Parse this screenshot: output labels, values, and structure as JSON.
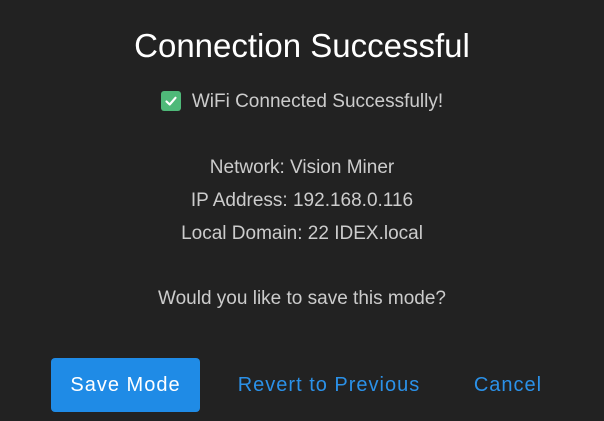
{
  "dialog": {
    "title": "Connection Successful",
    "status": {
      "icon": "check-icon",
      "icon_color": "#4fb979",
      "text": "WiFi Connected Successfully!"
    },
    "network_line": "Network: Vision Miner",
    "ip_line": "IP Address: 192.168.0.116",
    "domain_line": "Local Domain: 22 IDEX.local",
    "question": "Would you like to save this mode?",
    "buttons": {
      "save": "Save Mode",
      "revert": "Revert to Previous",
      "cancel": "Cancel"
    },
    "colors": {
      "background": "#222222",
      "accent": "#1f8be6",
      "link": "#2b91e8"
    }
  }
}
